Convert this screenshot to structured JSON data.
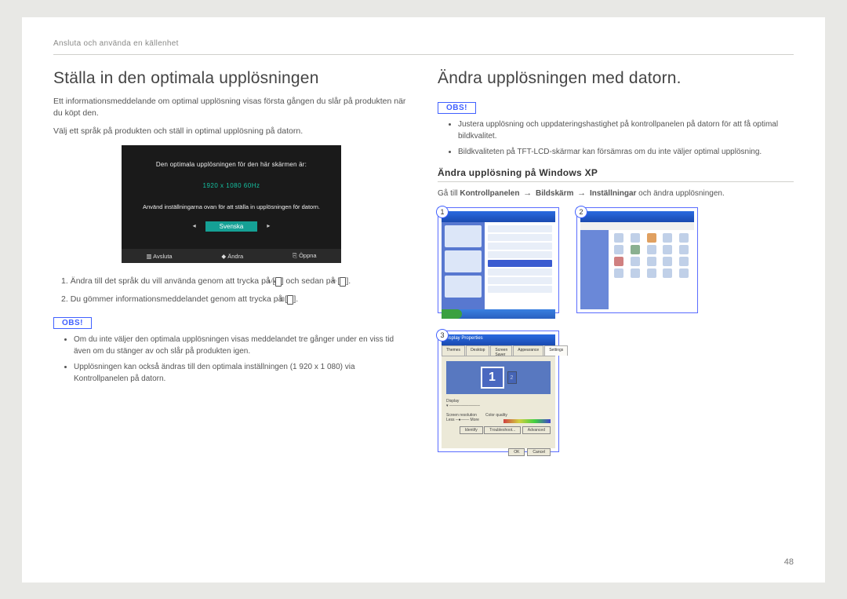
{
  "header": "Ansluta och använda en källenhet",
  "pageNumber": "48",
  "left": {
    "title": "Ställa in den optimala upplösningen",
    "p1": "Ett informationsmeddelande om optimal upplösning visas första gången du slår på produkten när du köpt den.",
    "p2": "Välj ett språk på produkten och ställ in optimal upplösning på datorn.",
    "osd": {
      "line1": "Den optimala upplösningen för den här skärmen är:",
      "resolution": "1920 x 1080  60Hz",
      "line3": "Använd inställningarna ovan för att ställa in upplösningen för datorn.",
      "lang": "Svenska",
      "btn1": "Avsluta",
      "btn2": "Ändra",
      "btn3": "Öppna"
    },
    "step1a": "Ändra till det språk du vill använda genom att trycka på [",
    "step1b": "] och sedan på [",
    "step1c": "].",
    "step2a": "Du gömmer informationsmeddelandet genom att trycka på [",
    "step2b": "].",
    "obsLabel": "OBS!",
    "bullet1": "Om du inte väljer den optimala upplösningen visas meddelandet tre gånger under en viss tid även om du stänger av och slår på produkten igen.",
    "bullet2": "Upplösningen kan också ändras till den optimala inställningen (1 920 x 1 080) via Kontrollpanelen på datorn."
  },
  "right": {
    "title": "Ändra upplösningen med datorn.",
    "obsLabel": "OBS!",
    "bullet1": "Justera upplösning och uppdateringshastighet på kontrollpanelen på datorn för att få optimal bildkvalitet.",
    "bullet2": "Bildkvaliteten på TFT-LCD-skärmar kan försämras om du inte väljer optimal upplösning.",
    "subheading": "Ändra upplösning på Windows XP",
    "path_prefix": "Gå till ",
    "path_k": "Kontrollpanelen",
    "path_b": "Bildskärm",
    "path_i": "Inställningar",
    "path_suffix": " och ändra upplösningen.",
    "shot1": "1",
    "shot2": "2",
    "shot3": "3",
    "displayProps": "Display Properties",
    "tab1": "Themes",
    "tab2": "Desktop",
    "tab3": "Screen Saver",
    "tab4": "Appearance",
    "tab5": "Settings",
    "btnIdentify": "Identify",
    "btnTrouble": "Troubleshoot...",
    "btnAdv": "Advanced",
    "btnOk": "OK",
    "btnCancel": "Cancel"
  }
}
